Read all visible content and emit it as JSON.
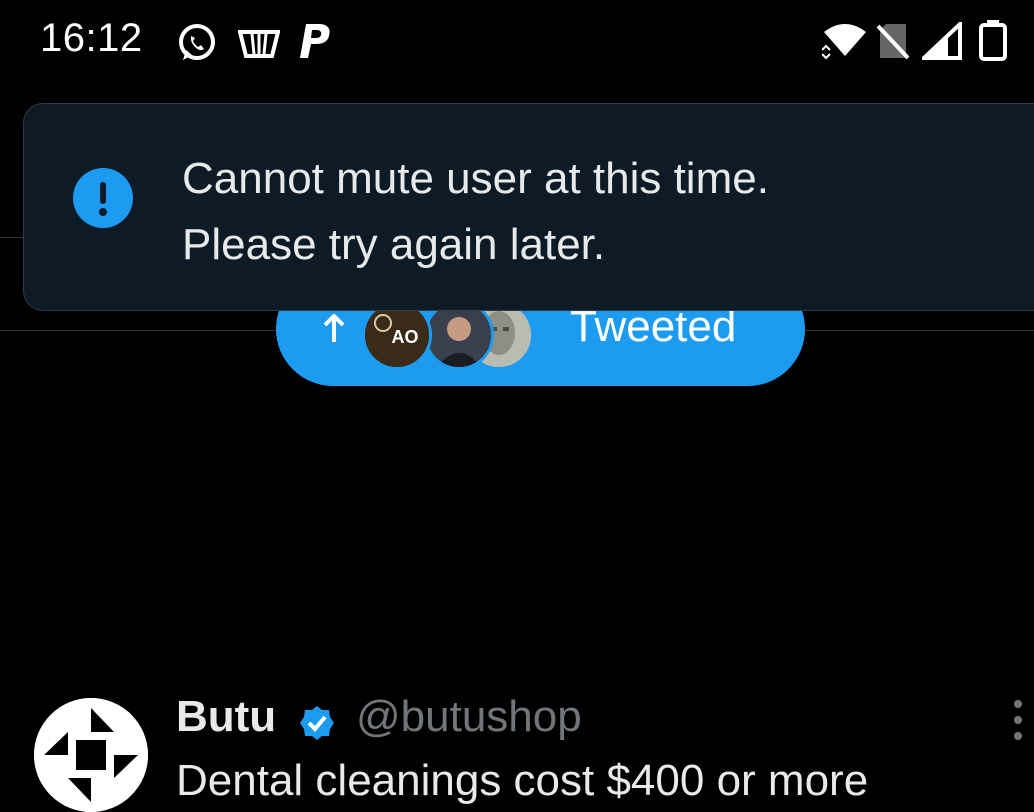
{
  "status_bar": {
    "time": "16:12",
    "notification_icons": [
      "whatsapp-icon",
      "basket-icon",
      "paypal-icon"
    ],
    "system_icons": [
      "wifi-icon",
      "no-sim-icon",
      "signal-icon",
      "battery-icon"
    ]
  },
  "toast": {
    "icon": "alert-icon",
    "line1": "Cannot mute user at this time.",
    "line2": "Please try again later.",
    "accent_color": "#1d9bf0"
  },
  "new_tweets_pill": {
    "label": "Tweeted",
    "first_avatar_text": "AO",
    "color": "#1d9bf0"
  },
  "tweet": {
    "author_name": "Butu",
    "author_handle": "@butushop",
    "text": "Dental cleanings cost $400 or more"
  }
}
